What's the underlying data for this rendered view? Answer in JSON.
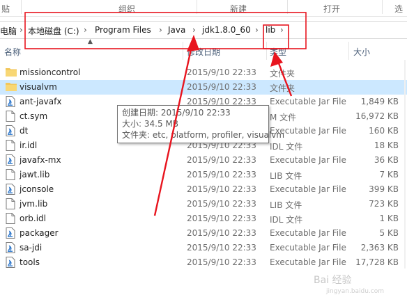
{
  "ribbon": {
    "group_left": "贴",
    "group_organize": "组织",
    "group_new": "新建",
    "group_open": "打开",
    "group_select": "选"
  },
  "address": {
    "crumbs": [
      "电脑",
      "本地磁盘 (C:)",
      "Program Files",
      "Java",
      "jdk1.8.0_60",
      "lib"
    ]
  },
  "columns": {
    "name": "名称",
    "date": "修改日期",
    "type": "类型",
    "size": "大小"
  },
  "files": [
    {
      "name": "missioncontrol",
      "date": "2015/9/10 22:33",
      "type": "文件夹",
      "size": "",
      "icon": "folder-icon"
    },
    {
      "name": "visualvm",
      "date": "2015/9/10 22:33",
      "type": "文件夹",
      "size": "",
      "icon": "folder-icon"
    },
    {
      "name": "ant-javafx",
      "date": "2015/9/10 22:33",
      "type": "Executable Jar File",
      "size": "1,849 KB",
      "icon": "jar-file-icon"
    },
    {
      "name": "ct.sym",
      "date": "2015/9/10 22:33",
      "type": "M 文件",
      "size": "16,972 KB",
      "icon": "file-icon"
    },
    {
      "name": "dt",
      "date": "2015/9/10 22:33",
      "type": "Executable Jar File",
      "size": "160 KB",
      "icon": "jar-file-icon"
    },
    {
      "name": "ir.idl",
      "date": "2015/9/10 22:33",
      "type": "IDL 文件",
      "size": "18 KB",
      "icon": "file-icon"
    },
    {
      "name": "javafx-mx",
      "date": "2015/9/10 22:33",
      "type": "Executable Jar File",
      "size": "36 KB",
      "icon": "jar-file-icon"
    },
    {
      "name": "jawt.lib",
      "date": "2015/9/10 22:33",
      "type": "LIB 文件",
      "size": "7 KB",
      "icon": "file-icon"
    },
    {
      "name": "jconsole",
      "date": "2015/9/10 22:33",
      "type": "Executable Jar File",
      "size": "399 KB",
      "icon": "jar-file-icon"
    },
    {
      "name": "jvm.lib",
      "date": "2015/9/10 22:33",
      "type": "LIB 文件",
      "size": "723 KB",
      "icon": "file-icon"
    },
    {
      "name": "orb.idl",
      "date": "2015/9/10 22:33",
      "type": "IDL 文件",
      "size": "1 KB",
      "icon": "file-icon"
    },
    {
      "name": "packager",
      "date": "2015/9/10 22:33",
      "type": "Executable Jar File",
      "size": "5 KB",
      "icon": "jar-file-icon"
    },
    {
      "name": "sa-jdi",
      "date": "2015/9/10 22:33",
      "type": "Executable Jar File",
      "size": "2,363 KB",
      "icon": "jar-file-icon"
    },
    {
      "name": "tools",
      "date": "2015/9/10 22:33",
      "type": "Executable Jar File",
      "size": "17,728 KB",
      "icon": "jar-file-icon"
    }
  ],
  "selected_index": 1,
  "tooltip": {
    "created": "创建日期: 2015/9/10 22:33",
    "size": "大小: 34.5 MB",
    "folders": "文件夹: etc, platform, profiler, visualvm"
  },
  "watermark": {
    "text": "Bai 经验",
    "url": "jingyan.baidu.com"
  },
  "colors": {
    "selection": "#cce8ff",
    "annotation_red": "#e8141e",
    "folder": "#f2c75c"
  }
}
